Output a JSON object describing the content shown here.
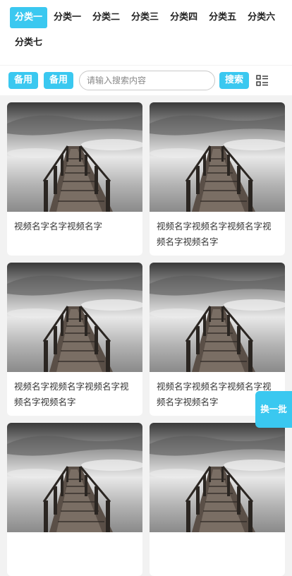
{
  "tabs": [
    "分类一",
    "分类一",
    "分类二",
    "分类三",
    "分类四",
    "分类五",
    "分类六",
    "分类七"
  ],
  "toolbar": {
    "btn1_label": "备用",
    "btn2_label": "备用",
    "search_placeholder": "请输入搜索内容",
    "search_label": "搜索",
    "view_icon": "list-grid-icon"
  },
  "videos": [
    {
      "title": "视频名字名字视频名字"
    },
    {
      "title": "视频名字视频名字视频名字视频名字视频名字"
    },
    {
      "title": "视频名字视频名字视频名字视频名字视频名字"
    },
    {
      "title": "视频名字视频名字视频名字视频名字视频名字"
    },
    {
      "title": ""
    },
    {
      "title": ""
    }
  ],
  "float_button_label": "换一批",
  "colors": {
    "accent": "#3ac8f0",
    "background": "#f2f2f2"
  }
}
